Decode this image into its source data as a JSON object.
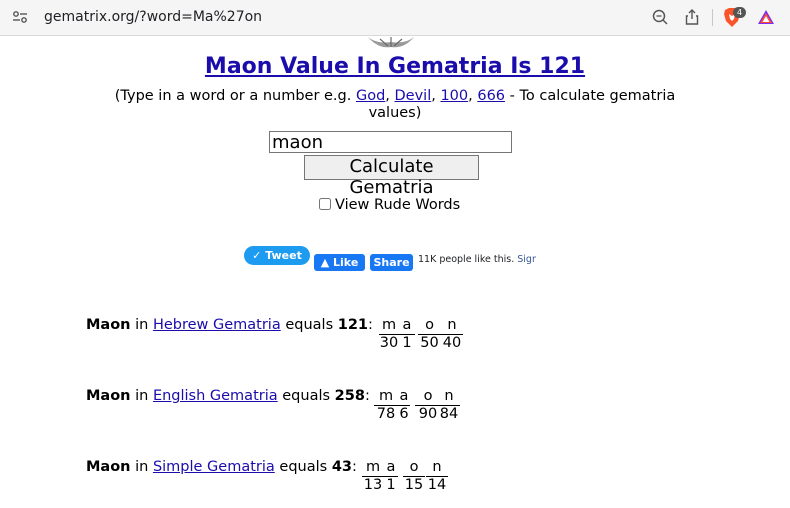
{
  "browser": {
    "url": "gematrix.org/?word=Ma%27on",
    "shield_count": "4"
  },
  "page": {
    "title": "Maon Value In Gematria Is 121",
    "intro_before": "(Type in a word or a number e.g. ",
    "examples": [
      "God",
      "Devil",
      "100",
      "666"
    ],
    "intro_after": " - To calculate gematria values)",
    "input_value": "maon",
    "calculate_label": "Calculate Gematria",
    "rude_label": "View Rude Words"
  },
  "social": {
    "tweet_label": "Tweet",
    "like_label": "Like",
    "share_label": "Share",
    "likes_text": "11K people like this.",
    "sign_text": "Sign"
  },
  "results": [
    {
      "word": "Maon",
      "in": "in",
      "system": "Hebrew Gematria",
      "equals": "equals",
      "value": "121",
      "letters": [
        "m",
        "a",
        "o",
        "n"
      ],
      "values": [
        "30",
        "1",
        "50",
        "40"
      ]
    },
    {
      "word": "Maon",
      "in": "in",
      "system": "English Gematria",
      "equals": "equals",
      "value": "258",
      "letters": [
        "m",
        "a",
        "o",
        "n"
      ],
      "values": [
        "78",
        "6",
        "90",
        "84"
      ]
    },
    {
      "word": "Maon",
      "in": "in",
      "system": "Simple Gematria",
      "equals": "equals",
      "value": "43",
      "letters": [
        "m",
        "a",
        "o",
        "n"
      ],
      "values": [
        "13",
        "1",
        "15",
        "14"
      ]
    }
  ],
  "colors": {
    "link": "#1a0dab",
    "tweet": "#1d9bf0",
    "facebook": "#1877f2"
  }
}
